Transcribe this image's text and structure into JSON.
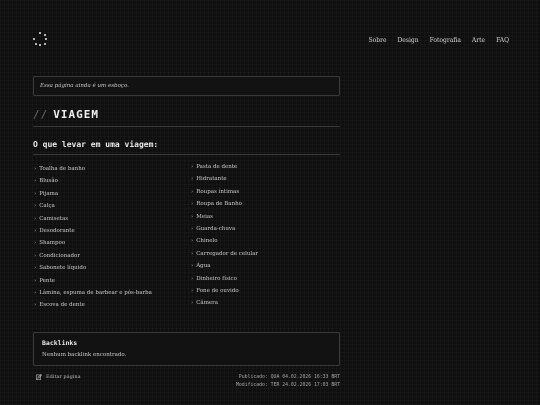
{
  "nav": {
    "items": [
      "Sobre",
      "Design",
      "Fotografia",
      "Arte",
      "FAQ"
    ]
  },
  "notice": {
    "text": "Essa página ainda é um esboço."
  },
  "page": {
    "title_prefix": "//",
    "title": "VIAGEM",
    "subtitle": "O que levar em uma viagem:"
  },
  "list": {
    "left": [
      "Toalha de banho",
      "Blusão",
      "Pijama",
      "Calça",
      "Camisetas",
      "Desodorante",
      "Shampoo",
      "Condicionador",
      "Sabonete líquido",
      "Pente",
      "Lâmina, espuma de barbear e pós-barba",
      "Escova de dente"
    ],
    "right": [
      "Pasta de dente",
      "Hidratante",
      "Roupas íntimas",
      "Roupa de Banho",
      "Meias",
      "Guarda-chuva",
      "Chinelo",
      "Carregador de celular",
      "Água",
      "Dinheiro físico",
      "Fone de ouvido",
      "Câmera"
    ]
  },
  "backlinks": {
    "heading": "Backlinks",
    "text": "Nenhum backlink encontrado."
  },
  "footer": {
    "edit_label": "Editar página",
    "published": "Publicado: QUA 04.02.2026 16:33 BRT",
    "modified": "Modificado: TER 24.02.2026 17:03 BRT"
  }
}
